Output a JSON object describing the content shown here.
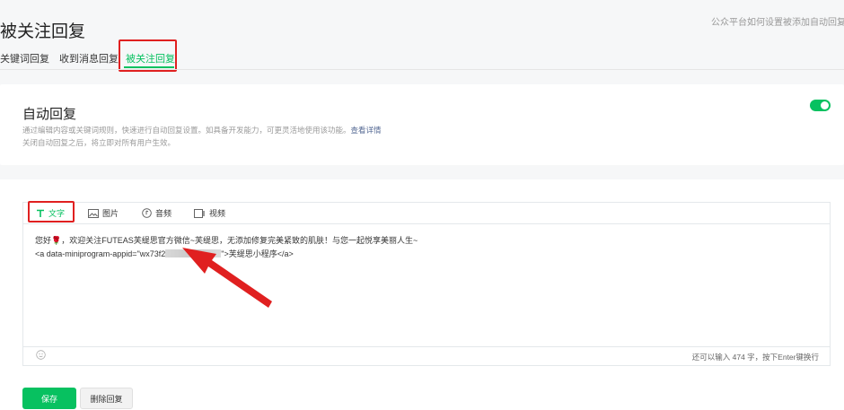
{
  "page": {
    "title": "被关注回复",
    "help_link": "公众平台如何设置被添加自动回复"
  },
  "tabs": [
    {
      "label": "关键词回复"
    },
    {
      "label": "收到消息回复"
    },
    {
      "label": "被关注回复",
      "active": true
    }
  ],
  "auto_reply": {
    "title": "自动回复",
    "desc_1": "通过编辑内容或关键词规则，快速进行自动回复设置。如具备开发能力，可更灵活地使用该功能。",
    "desc_link": "查看详情",
    "desc_2": "关闭自动回复之后，将立即对所有用户生效。",
    "enabled": true
  },
  "editor": {
    "tabs": [
      {
        "label": "文字",
        "icon": "text-icon",
        "active": true
      },
      {
        "label": "图片",
        "icon": "image-icon"
      },
      {
        "label": "音频",
        "icon": "audio-icon"
      },
      {
        "label": "视频",
        "icon": "video-icon"
      }
    ],
    "line_1": "您好🌹，欢迎关注FUTEAS芙缇思官方微信~芙缇思，无添加修复完美紧致的肌肤！与您一起悦享美丽人生~",
    "line_2_prefix": "<a data-miniprogram-appid=\"wx73f2",
    "line_2_suffix": "\">芙缇思小程序</a>",
    "counter": "还可以输入 474 字，按下Enter键换行"
  },
  "buttons": {
    "save": "保存",
    "delete": "删除回复"
  },
  "colors": {
    "accent": "#07c160",
    "annotation": "#e02020",
    "link": "#576b95"
  }
}
